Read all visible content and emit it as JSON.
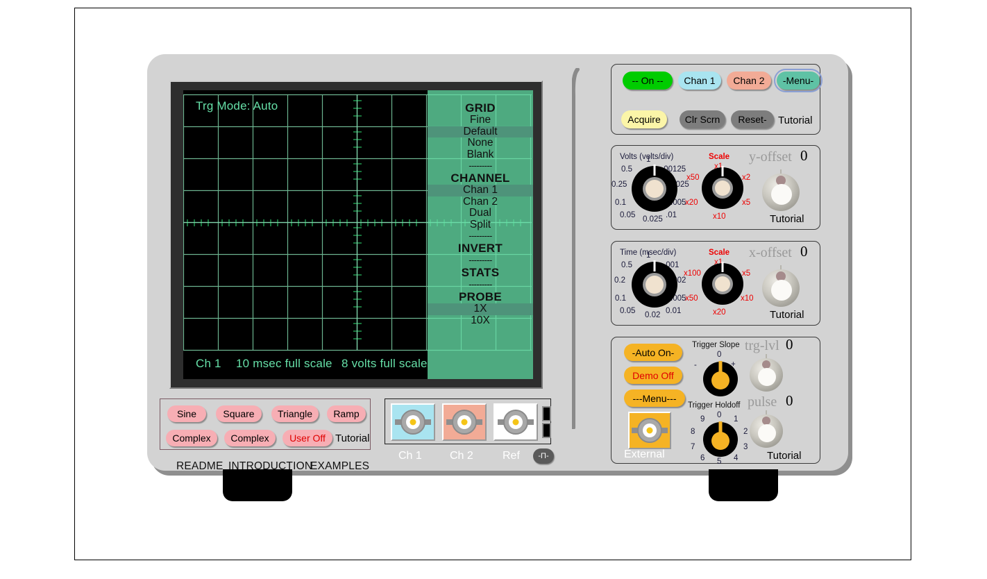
{
  "screen": {
    "trg_mode": "Trg Mode: Auto",
    "status_channel": "Ch 1",
    "status_time": "10 msec full scale",
    "status_volts": "8 volts full scale",
    "grid_cols": 10,
    "grid_rows": 8,
    "trace_color": "#66e0a8",
    "background": "#000000"
  },
  "screen_menu": {
    "groups": [
      {
        "heading": "GRID",
        "items": [
          "Fine",
          "Default",
          "None",
          "Blank"
        ],
        "selected": "Default"
      },
      {
        "heading": "CHANNEL",
        "items": [
          "Chan 1",
          "Chan 2",
          "Dual",
          "Split"
        ],
        "selected": "Chan 1"
      },
      {
        "heading": "INVERT",
        "items": [],
        "selected": ""
      },
      {
        "heading": "STATS",
        "items": [],
        "selected": ""
      },
      {
        "heading": "PROBE",
        "items": [
          "1X",
          "10X"
        ],
        "selected": "1X"
      }
    ],
    "separator": "---------",
    "highlight_color": "#4e937a",
    "overlay_color": "#66e0a8"
  },
  "waveform_panel": {
    "buttons": [
      {
        "label": "Sine",
        "color": "#f7aeb4",
        "text_color": "#000000"
      },
      {
        "label": "Square",
        "color": "#f7aeb4",
        "text_color": "#000000"
      },
      {
        "label": "Triangle",
        "color": "#f7aeb4",
        "text_color": "#000000"
      },
      {
        "label": "Ramp",
        "color": "#f7aeb4",
        "text_color": "#000000"
      },
      {
        "label": "Complex",
        "color": "#f7aeb4",
        "text_color": "#000000"
      },
      {
        "label": "Complex",
        "color": "#f7aeb4",
        "text_color": "#000000"
      },
      {
        "label": "User Off",
        "color": "#f7aeb4",
        "text_color": "#e00000"
      }
    ],
    "tutorial": "Tutorial"
  },
  "doc_links": [
    "README",
    "INTRODUCTION",
    "EXAMPLES"
  ],
  "bnc_panel": {
    "connectors": [
      {
        "label": "Ch 1",
        "color": "#a9e4f0"
      },
      {
        "label": "Ch 2",
        "color": "#f2ab96"
      },
      {
        "label": "Ref",
        "color": "#ffffff"
      }
    ],
    "cal_button": "-Π-"
  },
  "display_panel": {
    "row1": [
      {
        "label": "-- On --",
        "color": "#00cc00",
        "selected": false
      },
      {
        "label": "Chan 1",
        "color": "#a9e4f0",
        "selected": false
      },
      {
        "label": "Chan 2",
        "color": "#f2ab96",
        "selected": false
      },
      {
        "label": "-Menu-",
        "color": "#5fc2a5",
        "selected": true
      }
    ],
    "row2": [
      {
        "label": "Acquire",
        "color": "#fbf5a8"
      },
      {
        "label": "Clr Scrn",
        "color": "#7d7d7d"
      },
      {
        "label": "Reset-",
        "color": "#7d7d7d"
      }
    ],
    "tutorial": "Tutorial"
  },
  "volts_panel": {
    "main_title": "Volts (volts/div)",
    "main_ticks": [
      "0.5",
      "1",
      ".00125",
      "0.25",
      ".0025",
      "0.1",
      ".005",
      "0.05",
      "0.025",
      ".01"
    ],
    "scale_title": "Scale",
    "scale_ticks": [
      "x50",
      "x1",
      "x2",
      "x20",
      "x5",
      "x10"
    ],
    "offset_name": "y-offset",
    "offset_value": "0",
    "tutorial": "Tutorial"
  },
  "time_panel": {
    "main_title": "Time (msec/div)",
    "main_ticks": [
      "0.5",
      "1",
      ".001",
      "0.2",
      ".002",
      "0.1",
      ".005",
      "0.05",
      "0.02",
      "0.01"
    ],
    "scale_title": "Scale",
    "scale_ticks": [
      "x100",
      "x1",
      "x5",
      "x50",
      "x10",
      "x20"
    ],
    "offset_name": "x-offset",
    "offset_value": "0",
    "tutorial": "Tutorial"
  },
  "trigger_panel": {
    "buttons": [
      {
        "label": "-Auto On-",
        "color": "#f5b324",
        "text_color": "#000000"
      },
      {
        "label": "Demo Off",
        "color": "#f5b324",
        "text_color": "#e00000"
      },
      {
        "label": "---Menu---",
        "color": "#f5b324",
        "text_color": "#000000"
      }
    ],
    "external_label": "External",
    "slope_title": "Trigger Slope",
    "slope_ticks": [
      "-",
      "0",
      "+"
    ],
    "holdoff_title": "Trigger Holdoff",
    "holdoff_ticks": [
      "0",
      "1",
      "2",
      "3",
      "4",
      "5",
      "6",
      "7",
      "8",
      "9"
    ],
    "trg_lvl_name": "trg-lvl",
    "trg_lvl_value": "0",
    "pulse_name": "pulse",
    "pulse_value": "0",
    "tutorial": "Tutorial"
  }
}
